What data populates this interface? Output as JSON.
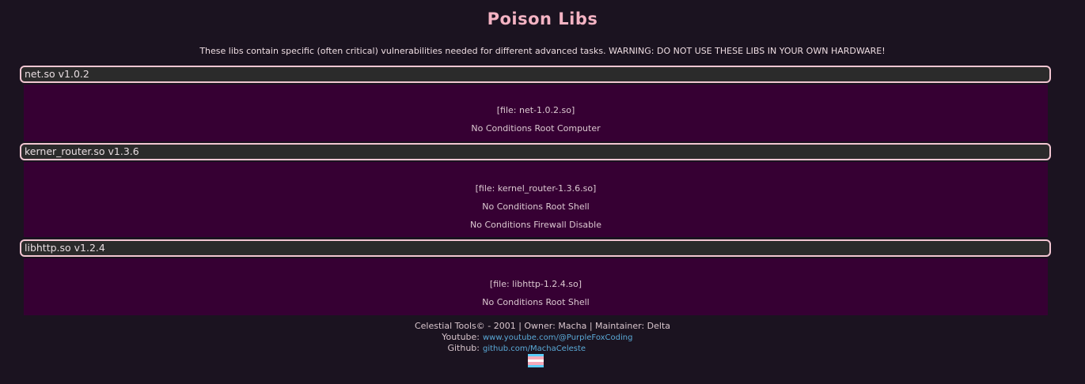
{
  "page": {
    "title": "Poison Libs",
    "subtitle": "These libs contain specific (often critical) vulnerabilities needed for different advanced tasks. WARNING: DO NOT USE THESE LIBS IN YOUR OWN HARDWARE!"
  },
  "libs": [
    {
      "name": "net.so v1.0.2",
      "file": "[file: net-1.0.2.so]",
      "exploits": [
        "No Conditions Root Computer"
      ]
    },
    {
      "name": "kerner_router.so v1.3.6",
      "file": "[file: kernel_router-1.3.6.so]",
      "exploits": [
        "No Conditions Root Shell",
        "No Conditions Firewall Disable"
      ]
    },
    {
      "name": "libhttp.so v1.2.4",
      "file": "[file: libhttp-1.2.4.so]",
      "exploits": [
        "No Conditions Root Shell"
      ]
    }
  ],
  "footer": {
    "credits": "Celestial Tools© - 2001 | Owner: Macha | Maintainer: Delta",
    "youtube_label": "Youtube:",
    "youtube_link": "www.youtube.com/@PurpleFoxCoding",
    "github_label": "Github:",
    "github_link": "github.com/MachaCeleste",
    "flag_icon": "transgender-flag-icon",
    "flag_colors": [
      "#5bcefa",
      "#f5a9b8",
      "#ffffff",
      "#f5a9b8",
      "#5bcefa"
    ]
  },
  "colors": {
    "background": "#1b1320",
    "title": "#f4b3c3",
    "header_bg": "#2b2b2b",
    "header_border": "#f3c6d2",
    "panel_bg": "#360033",
    "link": "#5aa9d6"
  }
}
